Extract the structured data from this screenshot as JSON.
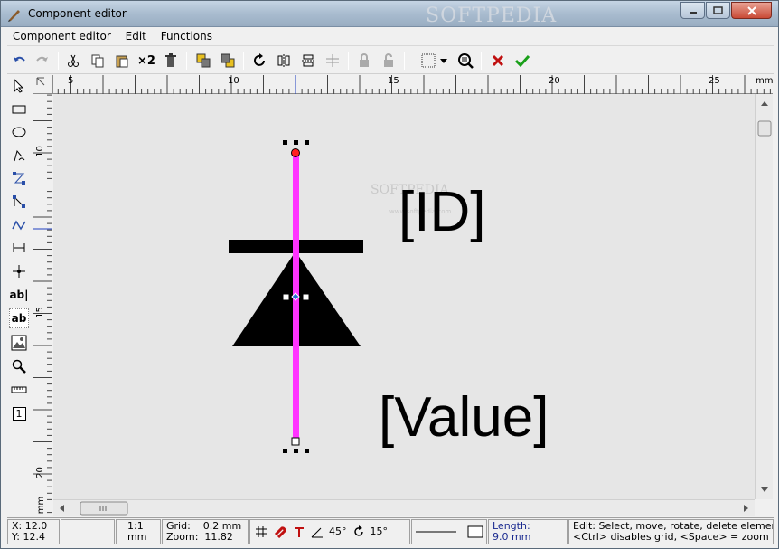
{
  "window": {
    "title": "Component editor",
    "watermark": "SOFTPEDIA"
  },
  "menu": [
    "Component editor",
    "Edit",
    "Functions"
  ],
  "toolbar": {
    "duplicate_label": "×2"
  },
  "ruler": {
    "unit": "mm",
    "h_ticks": [
      "5",
      "10",
      "15",
      "20",
      "25"
    ],
    "v_ticks": [
      "10",
      "15",
      "20"
    ]
  },
  "canvas": {
    "id_label": "[ID]",
    "value_label": "[Value]",
    "watermark": "SOFTPEDIA",
    "watermark_url": "www.softpedia.com",
    "part_color": "#ff33ff"
  },
  "left_tools": {
    "text_tool": "ab|",
    "text_tool2": "ab",
    "number_tool": "1"
  },
  "status": {
    "x": "X: 12.0",
    "y": "Y: 12.4",
    "scale": "1:1",
    "scale_unit": "mm",
    "grid_label": "Grid:",
    "grid_value": "0.2 mm",
    "zoom_label": "Zoom:",
    "zoom_value": "11.82",
    "angle1": "45°",
    "angle2": "15°",
    "length_label": "Length:",
    "length_value": "9.0 mm",
    "hint1": "Edit: Select, move, rotate, delete elements ...",
    "hint2": "<Ctrl> disables grid, <Space> = zoom"
  }
}
